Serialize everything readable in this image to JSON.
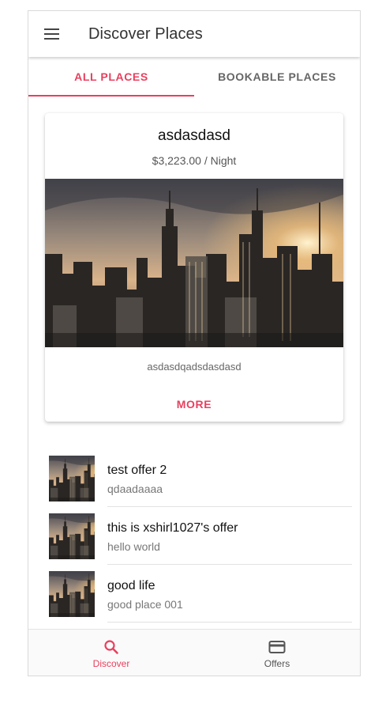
{
  "toolbar": {
    "title": "Discover Places",
    "menu_icon": "menu-icon"
  },
  "segments": [
    {
      "label": "ALL PLACES",
      "active": true
    },
    {
      "label": "BOOKABLE PLACES",
      "active": false
    }
  ],
  "featured": {
    "title": "asdasdasd",
    "price": "$3,223.00 / Night",
    "description": "asdasdqadsdasdasd",
    "more_label": "MORE"
  },
  "places": [
    {
      "title": "test offer 2",
      "subtitle": "qdaadaaaa"
    },
    {
      "title": "this is xshirl1027's offer",
      "subtitle": "hello world"
    },
    {
      "title": "good life",
      "subtitle": "good place 001"
    }
  ],
  "tabs": [
    {
      "label": "Discover",
      "icon": "search-icon",
      "active": true
    },
    {
      "label": "Offers",
      "icon": "card-icon",
      "active": false
    }
  ],
  "colors": {
    "accent": "#e8405f",
    "text": "#222222",
    "muted": "#777777"
  }
}
